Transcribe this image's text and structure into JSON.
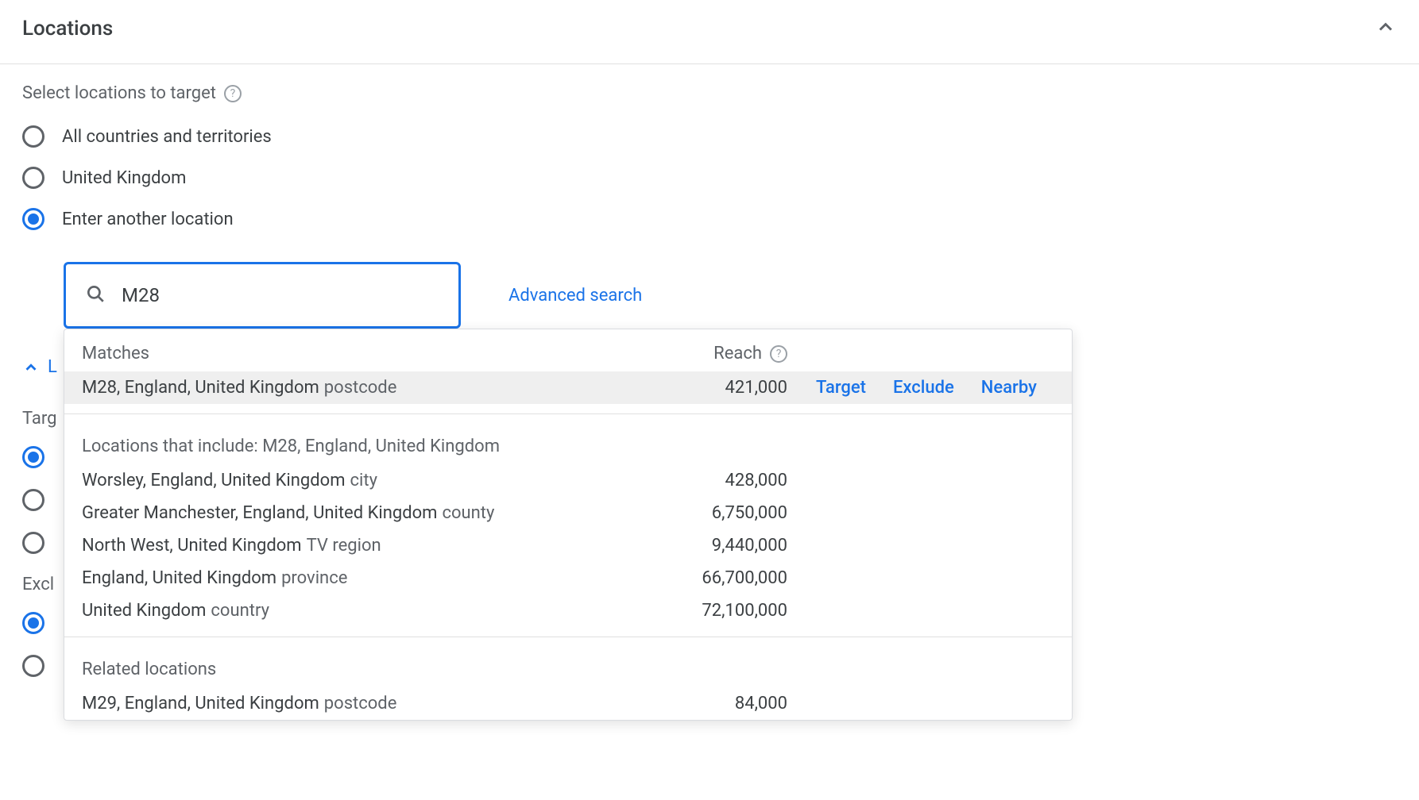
{
  "header": {
    "title": "Locations"
  },
  "sub_label": "Select locations to target",
  "options": {
    "all": "All countries and territories",
    "uk": "United Kingdom",
    "other": "Enter another location"
  },
  "search": {
    "value": "M28",
    "advanced": "Advanced search"
  },
  "dropdown": {
    "matches_header": "Matches",
    "reach_header": "Reach",
    "actions": {
      "target": "Target",
      "exclude": "Exclude",
      "nearby": "Nearby"
    },
    "primary": {
      "name": "M28, England, United Kingdom",
      "type": "postcode",
      "reach": "421,000"
    },
    "includes_label": "Locations that include: M28, England, United Kingdom",
    "includes": [
      {
        "name": "Worsley, England, United Kingdom",
        "type": "city",
        "reach": "428,000"
      },
      {
        "name": "Greater Manchester, England, United Kingdom",
        "type": "county",
        "reach": "6,750,000"
      },
      {
        "name": "North West, United Kingdom",
        "type": "TV region",
        "reach": "9,440,000"
      },
      {
        "name": "England, United Kingdom",
        "type": "province",
        "reach": "66,700,000"
      },
      {
        "name": "United Kingdom",
        "type": "country",
        "reach": "72,100,000"
      }
    ],
    "related_label": "Related locations",
    "related": [
      {
        "name": "M29, England, United Kingdom",
        "type": "postcode",
        "reach": "84,000"
      }
    ]
  },
  "behind": {
    "location_options_link": "L",
    "target_label": "Targ",
    "exclude_label": "Excl"
  }
}
